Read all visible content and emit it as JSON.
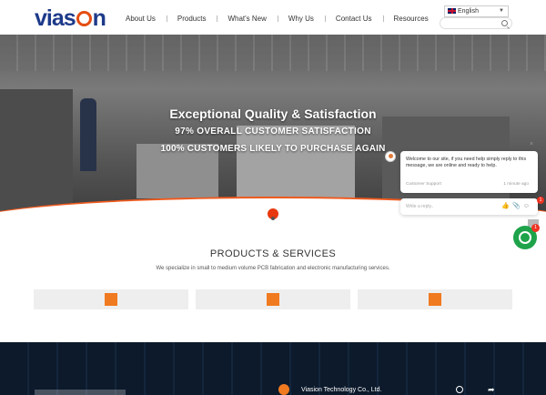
{
  "header": {
    "logo_text": "viasion",
    "nav": [
      "About Us",
      "Products",
      "What's New",
      "Why Us",
      "Contact Us",
      "Resources"
    ],
    "language": "English",
    "search_placeholder": ""
  },
  "hero": {
    "title": "Exceptional Quality & Satisfaction",
    "line1": "97% OVERALL CUSTOMER SATISFACTION",
    "line2": "100% CUSTOMERS LIKELY TO PURCHASE AGAIN"
  },
  "products": {
    "title": "PRODUCTS & SERVICES",
    "subtitle": "We specialize in small to medium volume PCB fabrication and electronic manufacturing services."
  },
  "video": {
    "title": "Viasion Technology Co., Ltd."
  },
  "chat": {
    "message": "Welcome to our site, if you need help simply reply to this message, we are online and ready to help.",
    "from": "Customer Support",
    "time": "1 minute ago",
    "input_placeholder": "Write a reply..",
    "badge_count": "1",
    "close_symbol": "×"
  },
  "colors": {
    "brand_blue": "#1d3a8a",
    "accent_orange": "#ef5a1e",
    "chat_green": "#1ea34a"
  }
}
